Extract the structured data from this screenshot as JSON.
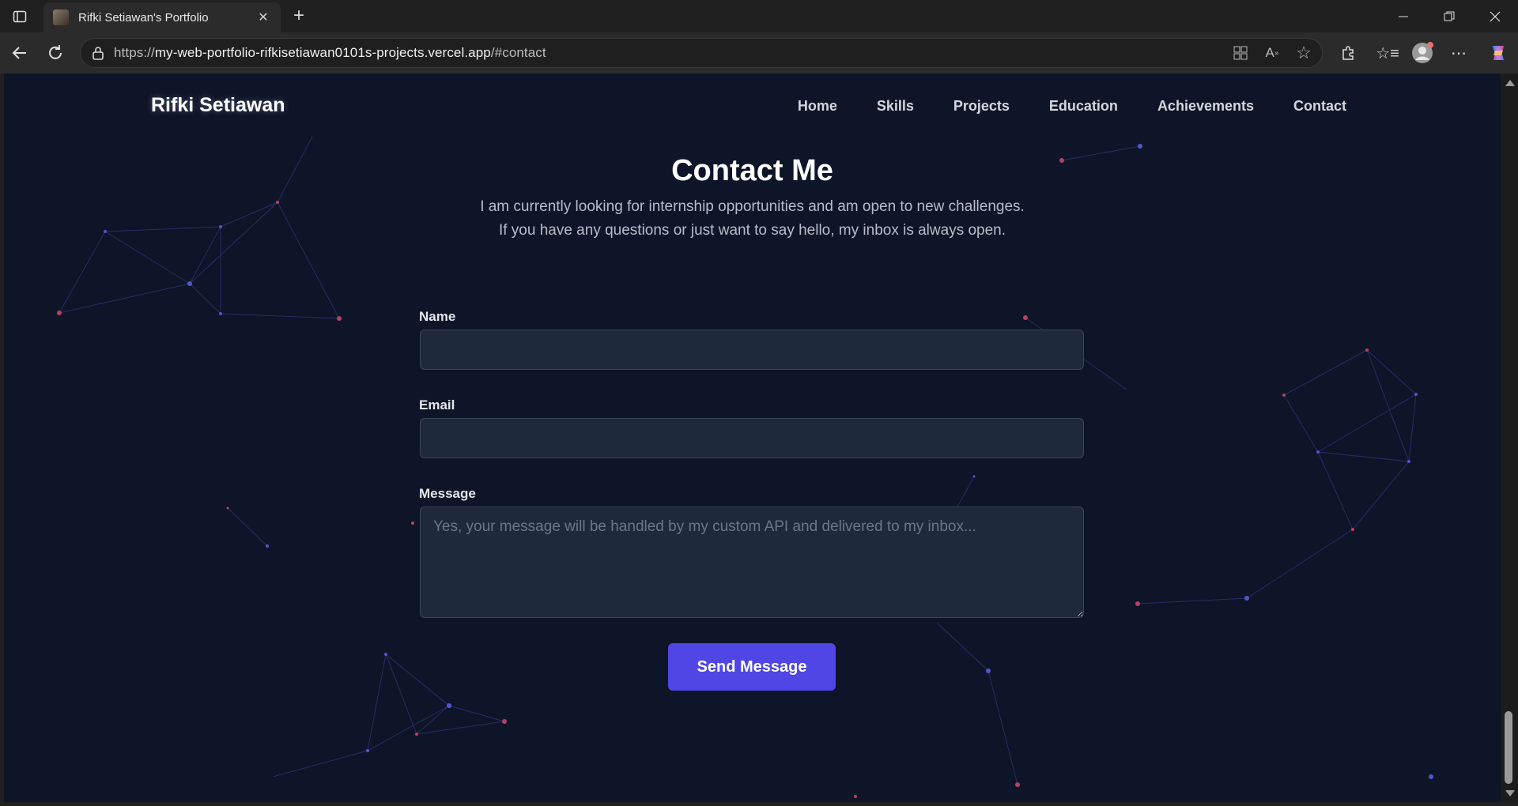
{
  "browser": {
    "tab_title": "Rifki Setiawan's Portfolio",
    "url_scheme": "https://",
    "url_host": "my-web-portfolio-rifkisetiawan0101s-projects.vercel.app",
    "url_path": "/#contact"
  },
  "site": {
    "brand": "Rifki Setiawan",
    "nav": [
      "Home",
      "Skills",
      "Projects",
      "Education",
      "Achievements",
      "Contact"
    ]
  },
  "contact": {
    "heading": "Contact Me",
    "subtitle_line1": "I am currently looking for internship opportunities and am open to new challenges.",
    "subtitle_line2": "If you have any questions or just want to say hello, my inbox is always open.",
    "name_label": "Name",
    "name_value": "",
    "email_label": "Email",
    "email_value": "",
    "message_label": "Message",
    "message_placeholder": "Yes, your message will be handled by my custom API and delivered to my inbox...",
    "send_label": "Send Message"
  },
  "colors": {
    "page_bg": "#0e1528",
    "field_bg": "#1e293b",
    "accent": "#4f46e5"
  }
}
